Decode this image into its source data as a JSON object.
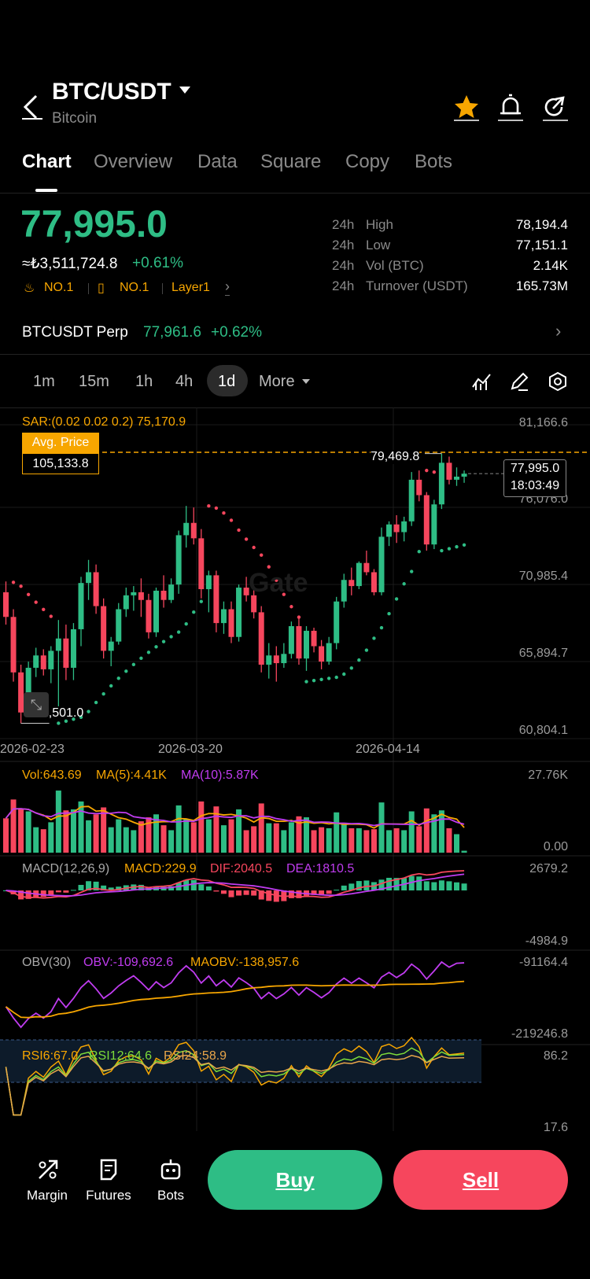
{
  "header": {
    "pair": "BTC/USDT",
    "subtitle": "Bitcoin"
  },
  "tabs": [
    "Chart",
    "Overview",
    "Data",
    "Square",
    "Copy",
    "Bots"
  ],
  "price": {
    "last": "77,995.0",
    "fiat": "≈₺3,511,724.8",
    "change": "+0.61%"
  },
  "badges": {
    "rank1": "NO.1",
    "rank2": "NO.1",
    "tag": "Layer1"
  },
  "stats": [
    {
      "a": "24h",
      "b": "High",
      "v": "78,194.4"
    },
    {
      "a": "24h",
      "b": "Low",
      "v": "77,151.1"
    },
    {
      "a": "24h",
      "b": "Vol (BTC)",
      "v": "2.14K"
    },
    {
      "a": "24h",
      "b": "Turnover (USDT)",
      "v": "165.73M"
    }
  ],
  "perp": {
    "name": "BTCUSDT Perp",
    "price": "77,961.6",
    "change": "+0.62%"
  },
  "timeframes": [
    "1m",
    "15m",
    "1h",
    "4h",
    "1d",
    "More"
  ],
  "main": {
    "sar": "SAR:(0.02 0.02 0.2) 75,170.9",
    "avg_label": "Avg. Price",
    "avg_value": "105,133.8",
    "y_ticks": [
      "81,166.6",
      "76,076.0",
      "70,985.4",
      "65,894.7",
      "60,804.1"
    ],
    "high_mark": "79,469.8",
    "low_mark": "62,501.0",
    "cur_price": "77,995.0",
    "countdown": "18:03:49",
    "dates": [
      "2026-02-23",
      "2026-03-20",
      "2026-04-14"
    ],
    "watermark": "Gate"
  },
  "vol": {
    "label": "Vol:643.69",
    "ma5": "MA(5):4.41K",
    "ma10": "MA(10):5.87K",
    "top": "27.76K",
    "bottom": "0.00"
  },
  "macd": {
    "label": "MACD(12,26,9)",
    "macd": "MACD:229.9",
    "dif": "DIF:2040.5",
    "dea": "DEA:1810.5",
    "top": "2679.2",
    "bottom": "-4984.9"
  },
  "obv": {
    "label": "OBV(30)",
    "obv": "OBV:-109,692.6",
    "maobv": "MAOBV:-138,957.6",
    "top": "-91164.4",
    "bottom": "-219246.8"
  },
  "rsi": {
    "r6": "RSI6:67.0",
    "r12": "RSI12:64.6",
    "r24": "RSI24:58.9",
    "top": "86.2",
    "bottom": "17.6"
  },
  "nav": {
    "margin": "Margin",
    "futures": "Futures",
    "bots": "Bots"
  },
  "actions": {
    "buy": "Buy",
    "sell": "Sell"
  },
  "colors": {
    "up": "#2ebd85",
    "down": "#f6465d",
    "accent": "#f7a600"
  },
  "chart_data": {
    "type": "candlestick",
    "ylim": [
      60804.1,
      81166.6
    ],
    "candles": [
      [
        70300,
        71000,
        68200,
        68700
      ],
      [
        68700,
        69200,
        64500,
        65100
      ],
      [
        65100,
        65600,
        61800,
        62500
      ],
      [
        62500,
        65800,
        62300,
        65400
      ],
      [
        65400,
        66700,
        64800,
        66200
      ],
      [
        66200,
        66600,
        64900,
        65300
      ],
      [
        65300,
        66800,
        64400,
        66500
      ],
      [
        66500,
        68500,
        62900,
        67300
      ],
      [
        67300,
        68200,
        64600,
        65400
      ],
      [
        65400,
        68300,
        64600,
        67900
      ],
      [
        67900,
        71300,
        66800,
        70900
      ],
      [
        70900,
        72400,
        69800,
        71600
      ],
      [
        71600,
        72100,
        68900,
        69400
      ],
      [
        69400,
        69900,
        66000,
        66500
      ],
      [
        66500,
        67400,
        65500,
        67100
      ],
      [
        67100,
        69600,
        66900,
        69200
      ],
      [
        69200,
        70600,
        68700,
        70100
      ],
      [
        70100,
        70700,
        69100,
        70300
      ],
      [
        70300,
        71200,
        68700,
        69800
      ],
      [
        69800,
        70200,
        67300,
        67700
      ],
      [
        67700,
        70600,
        67400,
        70400
      ],
      [
        70400,
        71400,
        69300,
        69800
      ],
      [
        69800,
        71200,
        69600,
        70800
      ],
      [
        70800,
        74300,
        70200,
        74000
      ],
      [
        74000,
        75900,
        73200,
        74800
      ],
      [
        74800,
        75800,
        73400,
        73800
      ],
      [
        73800,
        74400,
        69900,
        70500
      ],
      [
        70500,
        71700,
        69000,
        71400
      ],
      [
        71400,
        71700,
        67700,
        68300
      ],
      [
        68300,
        69700,
        67600,
        69200
      ],
      [
        69200,
        69700,
        67000,
        67400
      ],
      [
        67400,
        70800,
        67100,
        70600
      ],
      [
        70600,
        71300,
        69700,
        70100
      ],
      [
        70100,
        70600,
        68600,
        69000
      ],
      [
        69000,
        69400,
        65100,
        65600
      ],
      [
        65600,
        67000,
        64700,
        66200
      ],
      [
        66200,
        66800,
        64500,
        65700
      ],
      [
        65700,
        67000,
        65400,
        66300
      ],
      [
        66300,
        68400,
        66000,
        68100
      ],
      [
        68100,
        68600,
        65600,
        66000
      ],
      [
        66000,
        68100,
        65200,
        67800
      ],
      [
        67800,
        68000,
        66400,
        66800
      ],
      [
        66800,
        67200,
        65300,
        65800
      ],
      [
        65800,
        67400,
        65600,
        67000
      ],
      [
        67000,
        70000,
        66600,
        69700
      ],
      [
        69700,
        71500,
        69300,
        71100
      ],
      [
        71100,
        71900,
        70100,
        70700
      ],
      [
        70700,
        72300,
        70500,
        72200
      ],
      [
        72200,
        73000,
        71400,
        71600
      ],
      [
        71600,
        71800,
        70100,
        70300
      ],
      [
        70300,
        74500,
        70100,
        73900
      ],
      [
        73900,
        74900,
        73300,
        74700
      ],
      [
        74700,
        75300,
        73500,
        74200
      ],
      [
        74200,
        75200,
        73600,
        74900
      ],
      [
        74900,
        78100,
        74600,
        77600
      ],
      [
        77600,
        78200,
        76200,
        76600
      ],
      [
        76600,
        76800,
        73000,
        73400
      ],
      [
        73400,
        76300,
        73100,
        76000
      ],
      [
        76000,
        79300,
        75700,
        78700
      ],
      [
        78700,
        79100,
        77300,
        77600
      ],
      [
        77600,
        78400,
        77200,
        77800
      ],
      [
        77800,
        78200,
        77400,
        77995
      ]
    ]
  }
}
